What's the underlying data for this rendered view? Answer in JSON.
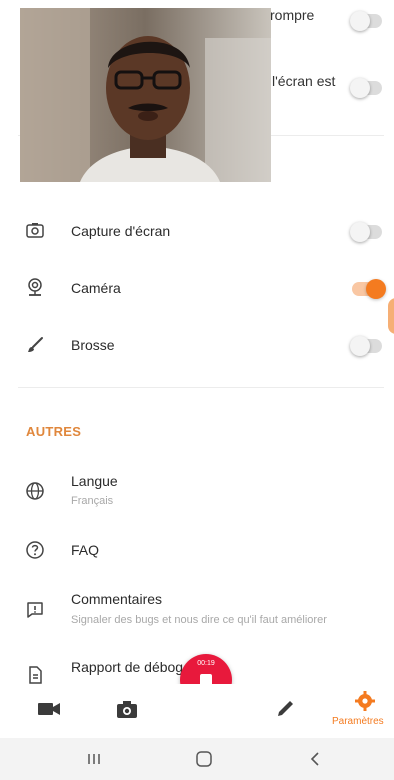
{
  "top_settings": {
    "partial_label_1": "rompre",
    "partial_label_2": "l'écran est",
    "toggle_1": "off",
    "toggle_2": "off"
  },
  "tools_section": {
    "items": [
      {
        "label": "Capture d'écran",
        "icon": "screenshot-icon",
        "toggle": "off"
      },
      {
        "label": "Caméra",
        "icon": "camera-icon",
        "toggle": "on"
      },
      {
        "label": "Brosse",
        "icon": "brush-icon",
        "toggle": "off"
      }
    ]
  },
  "others_section": {
    "title": "AUTRES",
    "items": [
      {
        "label": "Langue",
        "sub": "Français",
        "icon": "globe-icon"
      },
      {
        "label": "FAQ",
        "icon": "help-circle-icon"
      },
      {
        "label": "Commentaires",
        "sub": "Signaler des bugs et nous dire ce qu'il faut améliorer",
        "icon": "feedback-icon"
      },
      {
        "label": "Rapport de débog",
        "icon": "report-icon"
      }
    ]
  },
  "recording": {
    "time": "00:19"
  },
  "bottom_nav": {
    "items": [
      {
        "icon": "video-icon"
      },
      {
        "icon": "camera-icon"
      },
      {
        "icon": "pencil-icon"
      },
      {
        "icon": "settings-icon",
        "label": "Paramètres",
        "active": true
      }
    ]
  },
  "system_nav": {
    "recent_icon": "recent-apps-icon",
    "home_icon": "home-icon",
    "back_icon": "back-icon"
  },
  "colors": {
    "accent": "#f47b20",
    "section_title": "#e0873c",
    "record": "#e8193c"
  }
}
